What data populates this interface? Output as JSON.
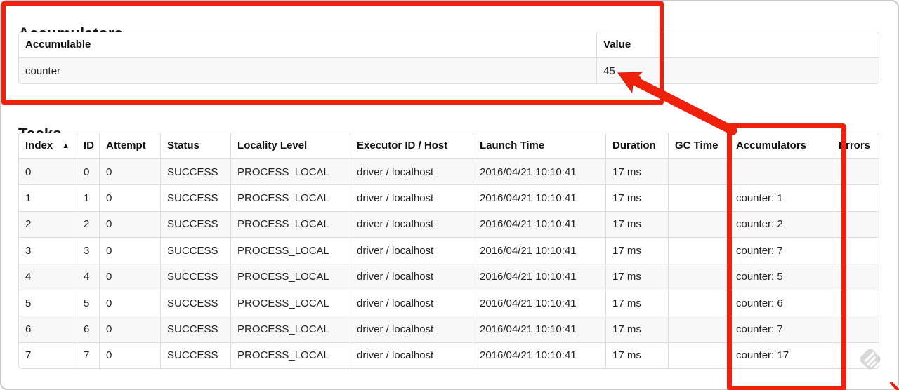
{
  "accumulators": {
    "heading": "Accumulators",
    "columns": [
      "Accumulable",
      "Value"
    ],
    "rows": [
      [
        "counter",
        "45"
      ]
    ]
  },
  "tasks": {
    "heading": "Tasks",
    "sort_icon": "▲",
    "columns": [
      "Index",
      "ID",
      "Attempt",
      "Status",
      "Locality Level",
      "Executor ID / Host",
      "Launch Time",
      "Duration",
      "GC Time",
      "Accumulators",
      "Errors"
    ],
    "rows": [
      [
        "0",
        "0",
        "0",
        "SUCCESS",
        "PROCESS_LOCAL",
        "driver / localhost",
        "2016/04/21 10:10:41",
        "17 ms",
        "",
        "",
        ""
      ],
      [
        "1",
        "1",
        "0",
        "SUCCESS",
        "PROCESS_LOCAL",
        "driver / localhost",
        "2016/04/21 10:10:41",
        "17 ms",
        "",
        "counter: 1",
        ""
      ],
      [
        "2",
        "2",
        "0",
        "SUCCESS",
        "PROCESS_LOCAL",
        "driver / localhost",
        "2016/04/21 10:10:41",
        "17 ms",
        "",
        "counter: 2",
        ""
      ],
      [
        "3",
        "3",
        "0",
        "SUCCESS",
        "PROCESS_LOCAL",
        "driver / localhost",
        "2016/04/21 10:10:41",
        "17 ms",
        "",
        "counter: 7",
        ""
      ],
      [
        "4",
        "4",
        "0",
        "SUCCESS",
        "PROCESS_LOCAL",
        "driver / localhost",
        "2016/04/21 10:10:41",
        "17 ms",
        "",
        "counter: 5",
        ""
      ],
      [
        "5",
        "5",
        "0",
        "SUCCESS",
        "PROCESS_LOCAL",
        "driver / localhost",
        "2016/04/21 10:10:41",
        "17 ms",
        "",
        "counter: 6",
        ""
      ],
      [
        "6",
        "6",
        "0",
        "SUCCESS",
        "PROCESS_LOCAL",
        "driver / localhost",
        "2016/04/21 10:10:41",
        "17 ms",
        "",
        "counter: 7",
        ""
      ],
      [
        "7",
        "7",
        "0",
        "SUCCESS",
        "PROCESS_LOCAL",
        "driver / localhost",
        "2016/04/21 10:10:41",
        "17 ms",
        "",
        "counter: 17",
        ""
      ]
    ]
  },
  "annotations": {
    "highlight_color": "#ee220c"
  }
}
